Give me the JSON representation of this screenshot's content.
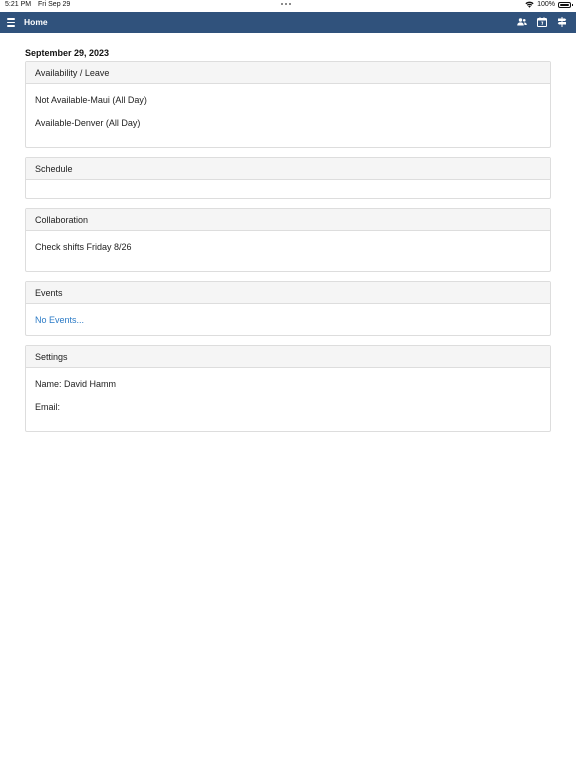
{
  "status_bar": {
    "time": "5:21 PM",
    "date": "Fri Sep 29",
    "battery": "100%",
    "icons": [
      "wifi-icon",
      "battery-icon"
    ]
  },
  "nav": {
    "title": "Home",
    "icons": [
      "menu-icon",
      "users-icon",
      "calendar-icon",
      "directions-icon"
    ]
  },
  "date_heading": "September 29, 2023",
  "sections": {
    "availability": {
      "title": "Availability / Leave",
      "items": [
        "Not Available-Maui (All Day)",
        "Available-Denver (All Day)"
      ]
    },
    "schedule": {
      "title": "Schedule"
    },
    "collaboration": {
      "title": "Collaboration",
      "items": [
        "Check shifts Friday 8/26"
      ]
    },
    "events": {
      "title": "Events",
      "link": "No Events..."
    },
    "settings": {
      "title": "Settings",
      "name": "Name: David Hamm",
      "email": "Email:"
    }
  },
  "colors": {
    "nav_background": "#30527c",
    "link": "#2a7ac6",
    "card_header": "#f5f5f5",
    "card_border": "#dddddd"
  }
}
